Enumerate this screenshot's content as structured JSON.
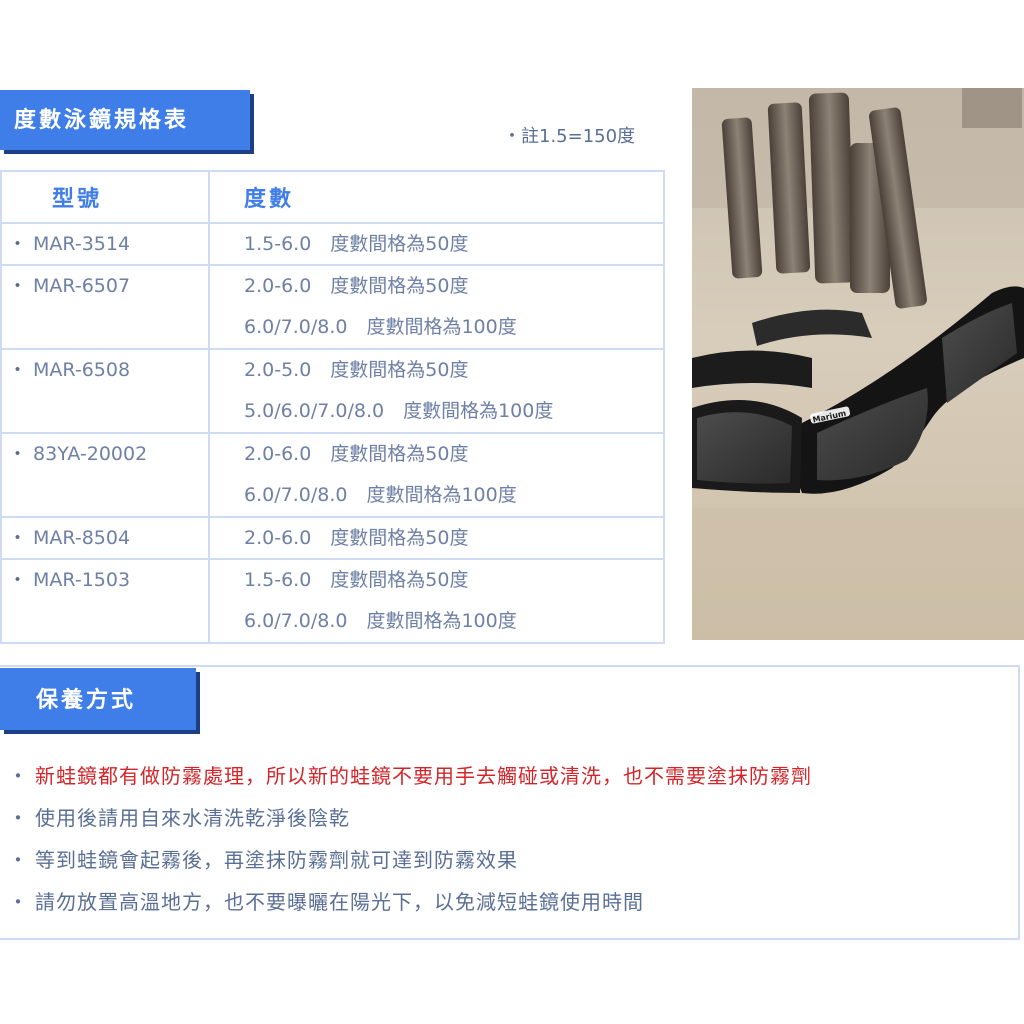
{
  "spec": {
    "title": "度數泳鏡規格表",
    "note": "・註1.5=150度",
    "headers": {
      "model": "型號",
      "degree": "度數"
    },
    "rows": [
      {
        "model": "MAR-3514",
        "lines": [
          "1.5-6.0　度數間格為50度"
        ]
      },
      {
        "model": "MAR-6507",
        "lines": [
          "2.0-6.0　度數間格為50度",
          "6.0/7.0/8.0　度數間格為100度"
        ]
      },
      {
        "model": "MAR-6508",
        "lines": [
          "2.0-5.0　度數間格為50度",
          "5.0/6.0/7.0/8.0　度數間格為100度"
        ]
      },
      {
        "model": "83YA-20002",
        "lines": [
          "2.0-6.0　度數間格為50度",
          "6.0/7.0/8.0　度數間格為100度"
        ]
      },
      {
        "model": "MAR-8504",
        "lines": [
          "2.0-6.0　度數間格為50度"
        ]
      },
      {
        "model": "MAR-1503",
        "lines": [
          "1.5-6.0　度數間格為50度",
          "6.0/7.0/8.0　度數間格為100度"
        ]
      }
    ]
  },
  "photo": {
    "brand": "Marium"
  },
  "care": {
    "title": "保養方式",
    "items": [
      {
        "parts": [
          "新蛙鏡都有做防霧處理，所以新的蛙鏡",
          "不要用手去觸碰或清洗，也不需要塗抹防霧劑"
        ]
      },
      {
        "parts": [
          "使用後請用自來水清洗乾淨後陰乾"
        ]
      },
      {
        "parts": [
          "等到蛙鏡會起霧後，再塗抹防霧劑就可達到防霧效果"
        ]
      },
      {
        "parts": [
          "請勿放置高溫地方，也不要曝曬在陽光下，以免減短蛙鏡使用時間"
        ]
      }
    ]
  },
  "colors": {
    "accent": "#3f7ee8",
    "text": "#5b6f96",
    "warning": "#d3262a",
    "border": "#cfdaf3"
  }
}
